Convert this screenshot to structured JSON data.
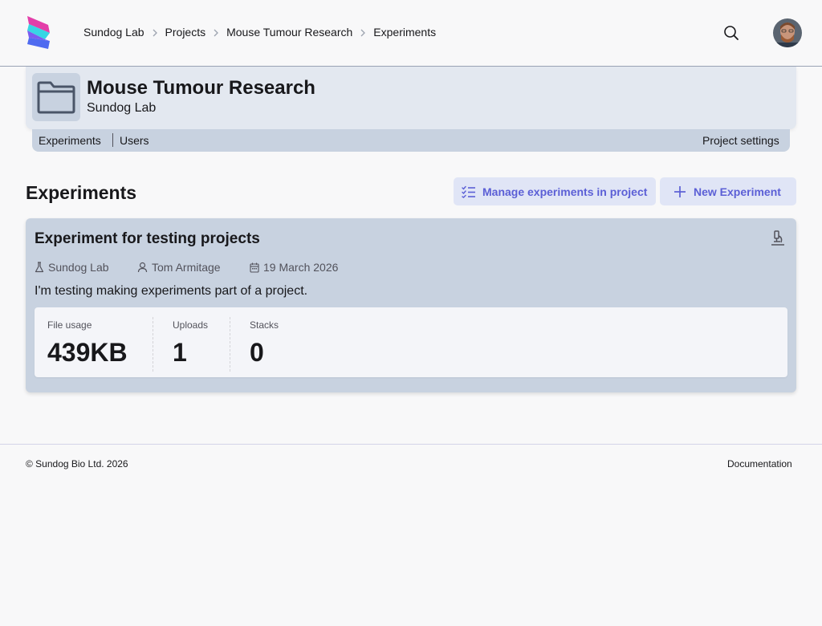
{
  "breadcrumb": [
    "Sundog Lab",
    "Projects",
    "Mouse Tumour Research",
    "Experiments"
  ],
  "project": {
    "title": "Mouse Tumour Research",
    "lab": "Sundog Lab",
    "tabs": [
      "Experiments",
      "Users"
    ],
    "settings_label": "Project settings"
  },
  "experiments_section": {
    "heading": "Experiments",
    "manage_label": "Manage experiments in project",
    "new_label": "New Experiment"
  },
  "experiment": {
    "title": "Experiment for testing projects",
    "lab": "Sundog Lab",
    "owner": "Tom Armitage",
    "date": "19 March 2026",
    "description": "I'm testing making experiments part of a project.",
    "stats": [
      {
        "label": "File usage",
        "value": "439KB"
      },
      {
        "label": "Uploads",
        "value": "1"
      },
      {
        "label": "Stacks",
        "value": "0"
      }
    ]
  },
  "footer": {
    "copyright": "© Sundog Bio Ltd. 2026",
    "docs": "Documentation"
  },
  "colors": {
    "accent": "#5b5fd6",
    "card_bg": "#c8d2e0",
    "header_card_bg": "#e3e8f0",
    "button_bg": "#e0e5f6"
  },
  "icons": [
    "sundog-logo-icon",
    "chevron-right-icon",
    "search-icon",
    "user-avatar",
    "folder-icon",
    "checklist-icon",
    "plus-icon",
    "microscope-icon",
    "flask-icon",
    "user-icon",
    "calendar-icon"
  ]
}
